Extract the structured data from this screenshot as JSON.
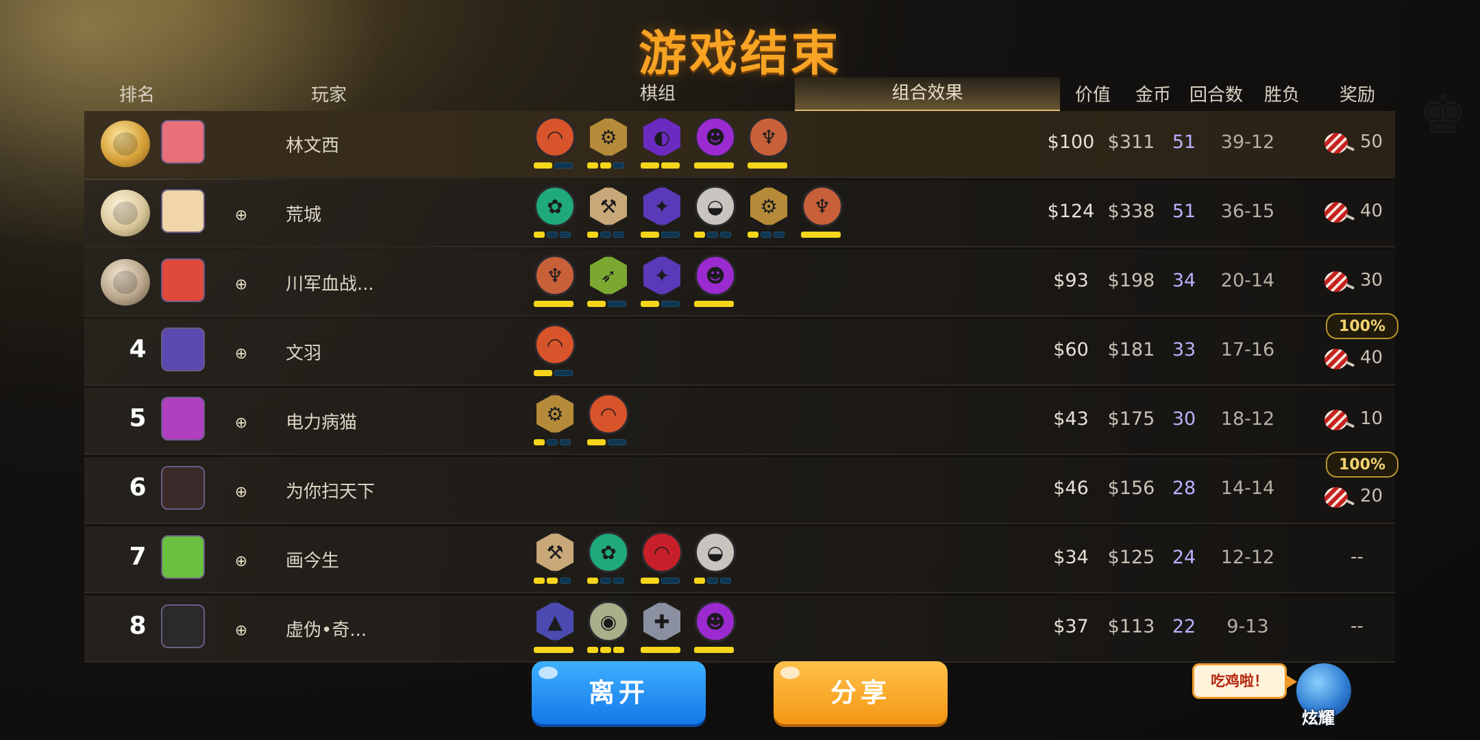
{
  "title": "游戏结束",
  "headers": {
    "rank": "排名",
    "player": "玩家",
    "lineup": "棋组",
    "synergy": "组合效果",
    "value": "价值",
    "gold": "金币",
    "rounds": "回合数",
    "winloss": "胜负",
    "reward": "奖励"
  },
  "rows": [
    {
      "rank": "",
      "medal": "gold",
      "name": "林文西",
      "value": "$100",
      "gold": "$311",
      "rounds": "51",
      "winloss": "39-12",
      "reward": "50",
      "boost": "",
      "combos": [
        {
          "shape": "circle",
          "color": "#d8542a",
          "glyph": "◠",
          "bars": [
            1,
            0
          ]
        },
        {
          "shape": "hex",
          "color": "#b58b3a",
          "glyph": "⚙",
          "bars": [
            1,
            1,
            0
          ]
        },
        {
          "shape": "hex",
          "color": "#6b2bc0",
          "glyph": "◐",
          "bars": [
            1,
            1
          ]
        },
        {
          "shape": "circle",
          "color": "#9b2bd0",
          "glyph": "☻",
          "bars": [
            1
          ]
        },
        {
          "shape": "circle",
          "color": "#c8603a",
          "glyph": "♆",
          "bars": [
            1
          ]
        }
      ]
    },
    {
      "rank": "",
      "medal": "silver",
      "name": "荒城",
      "value": "$124",
      "gold": "$338",
      "rounds": "51",
      "winloss": "36-15",
      "reward": "40",
      "boost": "",
      "combos": [
        {
          "shape": "circle",
          "color": "#1faa7a",
          "glyph": "✿",
          "bars": [
            1,
            0,
            0
          ]
        },
        {
          "shape": "hex",
          "color": "#c8a878",
          "glyph": "⚒",
          "bars": [
            1,
            0,
            0
          ]
        },
        {
          "shape": "hex",
          "color": "#5a3ab8",
          "glyph": "✦",
          "bars": [
            1,
            0
          ]
        },
        {
          "shape": "circle",
          "color": "#c8c4c0",
          "glyph": "◒",
          "bars": [
            1,
            0,
            0
          ]
        },
        {
          "shape": "hex",
          "color": "#b58b3a",
          "glyph": "⚙",
          "bars": [
            1,
            0,
            0
          ]
        },
        {
          "shape": "circle",
          "color": "#c8603a",
          "glyph": "♆",
          "bars": [
            1
          ]
        }
      ]
    },
    {
      "rank": "",
      "medal": "bronze",
      "name": "川军血战...",
      "value": "$93",
      "gold": "$198",
      "rounds": "34",
      "winloss": "20-14",
      "reward": "30",
      "boost": "",
      "combos": [
        {
          "shape": "circle",
          "color": "#c8603a",
          "glyph": "♆",
          "bars": [
            1
          ]
        },
        {
          "shape": "hex",
          "color": "#7aa830",
          "glyph": "➶",
          "bars": [
            1,
            0
          ]
        },
        {
          "shape": "hex",
          "color": "#5a3ab8",
          "glyph": "✦",
          "bars": [
            1,
            0
          ]
        },
        {
          "shape": "circle",
          "color": "#9b2bd0",
          "glyph": "☻",
          "bars": [
            1
          ]
        }
      ]
    },
    {
      "rank": "4",
      "medal": "",
      "name": "文羽",
      "value": "$60",
      "gold": "$181",
      "rounds": "33",
      "winloss": "17-16",
      "reward": "40",
      "boost": "100%",
      "combos": [
        {
          "shape": "circle",
          "color": "#d8542a",
          "glyph": "◠",
          "bars": [
            1,
            0
          ]
        }
      ]
    },
    {
      "rank": "5",
      "medal": "",
      "name": "电力病猫",
      "value": "$43",
      "gold": "$175",
      "rounds": "30",
      "winloss": "18-12",
      "reward": "10",
      "boost": "",
      "combos": [
        {
          "shape": "hex",
          "color": "#b58b3a",
          "glyph": "⚙",
          "bars": [
            1,
            0,
            0
          ]
        },
        {
          "shape": "circle",
          "color": "#d8542a",
          "glyph": "◠",
          "bars": [
            1,
            0
          ]
        }
      ]
    },
    {
      "rank": "6",
      "medal": "",
      "name": "为你扫天下",
      "value": "$46",
      "gold": "$156",
      "rounds": "28",
      "winloss": "14-14",
      "reward": "20",
      "boost": "100%",
      "combos": []
    },
    {
      "rank": "7",
      "medal": "",
      "name": "画今生",
      "value": "$34",
      "gold": "$125",
      "rounds": "24",
      "winloss": "12-12",
      "reward": "--",
      "boost": "",
      "combos": [
        {
          "shape": "hex",
          "color": "#c8a878",
          "glyph": "⚒",
          "bars": [
            1,
            1,
            0
          ]
        },
        {
          "shape": "circle",
          "color": "#1faa7a",
          "glyph": "✿",
          "bars": [
            1,
            0,
            0
          ]
        },
        {
          "shape": "circle",
          "color": "#c8202a",
          "glyph": "◠",
          "bars": [
            1,
            0
          ]
        },
        {
          "shape": "circle",
          "color": "#c8c4c0",
          "glyph": "◒",
          "bars": [
            1,
            0,
            0
          ]
        }
      ]
    },
    {
      "rank": "8",
      "medal": "",
      "name": "虚伪•奇...",
      "value": "$37",
      "gold": "$113",
      "rounds": "22",
      "winloss": "9-13",
      "reward": "--",
      "boost": "",
      "combos": [
        {
          "shape": "hex",
          "color": "#4a4ab0",
          "glyph": "▲",
          "bars": [
            1
          ]
        },
        {
          "shape": "circle",
          "color": "#a8b08a",
          "glyph": "◉",
          "bars": [
            1,
            1,
            1
          ]
        },
        {
          "shape": "hex",
          "color": "#8a90a0",
          "glyph": "✚",
          "bars": [
            1
          ]
        },
        {
          "shape": "circle",
          "color": "#9b2bd0",
          "glyph": "☻",
          "bars": [
            1
          ]
        }
      ]
    }
  ],
  "avatarColors": [
    "#e8707a",
    "#f0d6a8",
    "#e04a3a",
    "#5a4ab0",
    "#b040c0",
    "#3a2a2a",
    "#6ac040",
    "#2a2a2a"
  ],
  "buttons": {
    "leave": "离开",
    "share": "分享"
  },
  "bubble": "吃鸡啦！",
  "mascot_label": "炫耀"
}
